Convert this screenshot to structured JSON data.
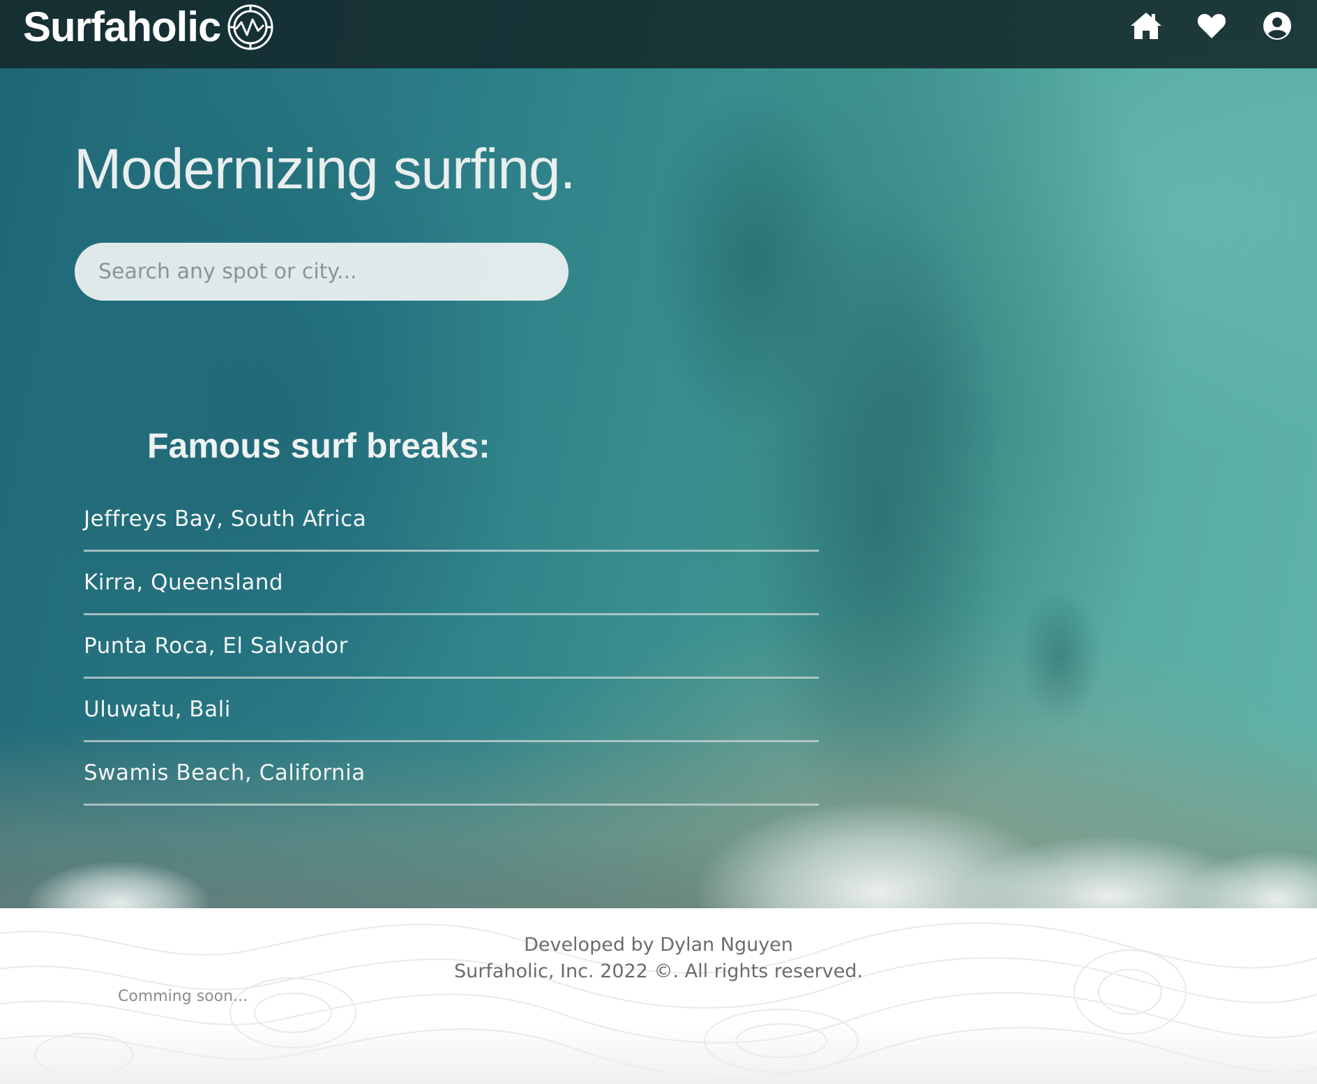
{
  "navbar": {
    "brand": "Surfaholic",
    "icons": [
      "home-icon",
      "heart-icon",
      "user-icon"
    ]
  },
  "hero": {
    "headline": "Modernizing surfing.",
    "search": {
      "placeholder": "Search any spot or city...",
      "value": ""
    },
    "breaks_title": "Famous surf breaks:",
    "breaks": [
      {
        "label": "Jeffreys Bay, South Africa"
      },
      {
        "label": "Kirra, Queensland"
      },
      {
        "label": "Punta Roca, El Salvador"
      },
      {
        "label": "Uluwatu, Bali"
      },
      {
        "label": "Swamis Beach, California"
      }
    ]
  },
  "footer": {
    "credit_line1": "Developed by Dylan Nguyen",
    "credit_line2": "Surfaholic, Inc. 2022 ©. All rights reserved.",
    "coming_soon": "Comming soon..."
  },
  "colors": {
    "navbar_bg": "#14282a",
    "ocean": "#2a7b86",
    "text_light": "#eef2f2"
  }
}
